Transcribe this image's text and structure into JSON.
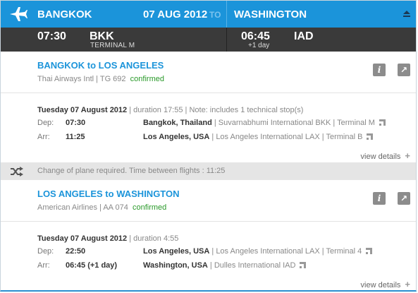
{
  "header": {
    "from_city": "BANGKOK",
    "date": "07 AUG 2012",
    "to_word": "TO",
    "to_city": "WASHINGTON",
    "dep_time": "07:30",
    "dep_code": "BKK",
    "dep_terminal": "TERMINAL M",
    "arr_time": "06:45",
    "arr_plus": "+1 day",
    "arr_code": "IAD"
  },
  "segments": [
    {
      "title": "BANGKOK to LOS ANGELES",
      "airline": "Thai Airways Intl | TG 692",
      "status": "confirmed",
      "date_bold": "Tuesday 07 August 2012",
      "date_rest": " | duration 17:55 | Note: includes 1 technical stop(s)",
      "dep_label": "Dep:",
      "dep_time": "07:30",
      "dep_city": "Bangkok, Thailand",
      "dep_detail": " | Suvarnabhumi International BKK | Terminal M",
      "arr_label": "Arr:",
      "arr_time": "11:25",
      "arr_city": "Los Angeles, USA",
      "arr_detail": " | Los Angeles International LAX | Terminal B",
      "view_details": "view details"
    },
    {
      "title": "LOS ANGELES to WASHINGTON",
      "airline": "American Airlines | AA 074",
      "status": "confirmed",
      "date_bold": "Tuesday 07 August 2012",
      "date_rest": " | duration 4:55",
      "dep_label": "Dep:",
      "dep_time": "22:50",
      "dep_city": "Los Angeles, USA",
      "dep_detail": " | Los Angeles International LAX | Terminal 4",
      "arr_label": "Arr:",
      "arr_time": "06:45 (+1 day)",
      "arr_city": "Washington, USA",
      "arr_detail": " | Dulles International IAD",
      "view_details": "view details"
    }
  ],
  "change": {
    "text": "Change of plane required. Time between flights : 11:25"
  },
  "icons": {
    "info": "i",
    "pin": "↗"
  },
  "colors": {
    "accent": "#1b94da",
    "dark_bar": "#3a3a3a",
    "confirmed": "#2a9a2a"
  }
}
